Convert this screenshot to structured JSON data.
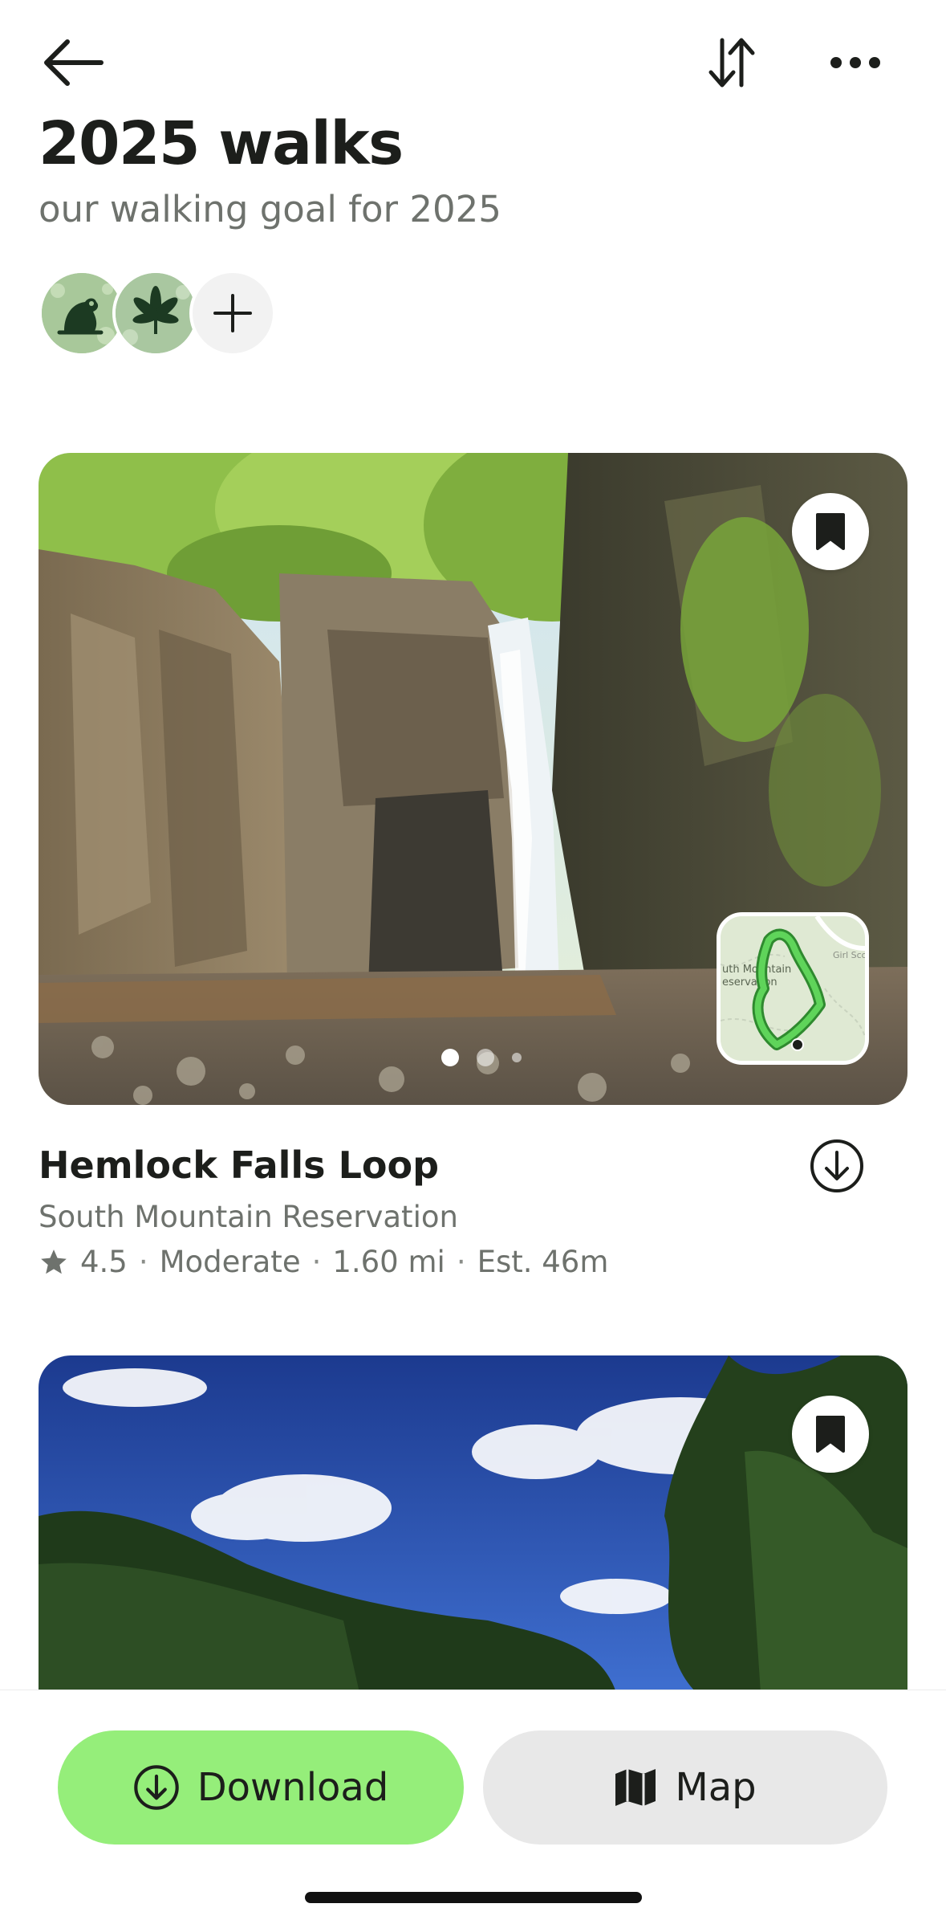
{
  "header": {
    "back_icon": "arrow-left-icon",
    "sort_icon": "sort-arrows-icon",
    "more_icon": "more-horizontal-icon"
  },
  "list": {
    "title": "2025 walks",
    "subtitle": "our walking goal for 2025"
  },
  "members": [
    {
      "icon": "frog-avatar-icon"
    },
    {
      "icon": "leaf-avatar-icon"
    },
    {
      "icon": "plus-icon"
    }
  ],
  "trails": [
    {
      "name": "Hemlock Falls Loop",
      "location": "South Mountain Reservation",
      "rating": "4.5",
      "difficulty": "Moderate",
      "length": "1.60 mi",
      "estimate": "Est. 46m",
      "separator": "·",
      "minimap_label": "uth Mountain\neservation",
      "minimap_label2": "Girl Scou"
    }
  ],
  "bottom_bar": {
    "download_label": "Download",
    "map_label": "Map"
  },
  "colors": {
    "accent_green": "#95ee7a",
    "secondary_button": "#e8e8e8",
    "muted_text": "#6e726d"
  }
}
